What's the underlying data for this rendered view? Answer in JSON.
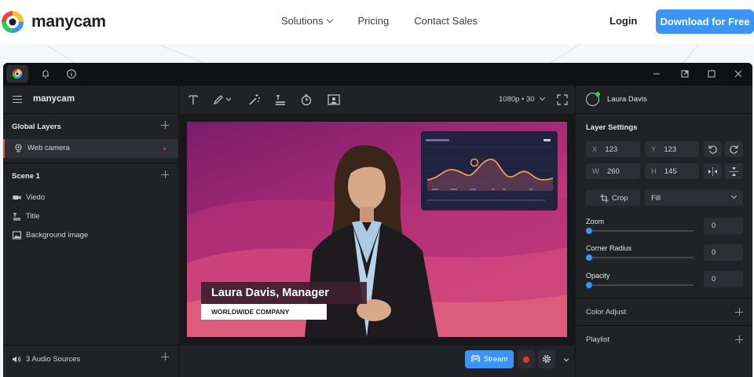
{
  "site": {
    "brand": "manycam",
    "nav": [
      {
        "label": "Solutions",
        "dropdown": true
      },
      {
        "label": "Pricing",
        "dropdown": false
      },
      {
        "label": "Contact Sales",
        "dropdown": false
      }
    ],
    "login": "Login",
    "download": "Download for Free",
    "accent": "#3b95f5"
  },
  "app": {
    "brand": "manycam",
    "resolution": "1080p • 30",
    "left": {
      "global_layers_title": "Global Layers",
      "global_layers": [
        {
          "label": "Web camera",
          "icon": "webcam-icon",
          "live": true
        }
      ],
      "scene_title": "Scene 1",
      "scene_layers": [
        {
          "label": "Viedo",
          "icon": "video-camera-icon"
        },
        {
          "label": "Title",
          "icon": "title-text-icon"
        },
        {
          "label": "Background image",
          "icon": "image-icon"
        }
      ],
      "audio": "3 Audio Sources"
    },
    "preview": {
      "lower_third_name": "Laura Davis, Manager",
      "lower_third_company": "WORLDWIDE COMPANY"
    },
    "bottom": {
      "stream_label": "Stream"
    },
    "right": {
      "user_name": "Laura Davis",
      "layer_settings_title": "Layer Settings",
      "x_label": "X",
      "x_value": "123",
      "y_label": "Y",
      "y_value": "123",
      "w_label": "W",
      "w_value": "260",
      "h_label": "H",
      "h_value": "145",
      "crop_label": "Crop",
      "fit_value": "Fill",
      "sliders": [
        {
          "label": "Zoom",
          "value": "0"
        },
        {
          "label": "Corner Radius",
          "value": "0"
        },
        {
          "label": "Opacity",
          "value": "0"
        }
      ],
      "color_adjust": "Color Adjust",
      "playlist": "Playlist"
    }
  }
}
